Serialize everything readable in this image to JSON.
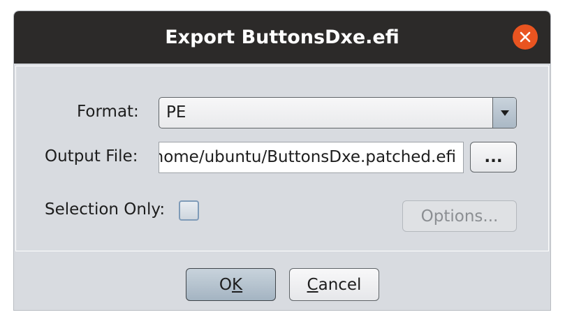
{
  "dialog": {
    "title": "Export ButtonsDxe.efi",
    "close_icon": "close-icon",
    "accent_color": "#e95420"
  },
  "form": {
    "format_label": "Format:",
    "format_value": "PE",
    "output_label": "Output File:",
    "output_value": "/home/ubuntu/ButtonsDxe.patched.efi",
    "browse_label": "...",
    "selection_label": "Selection Only:",
    "selection_checked": false,
    "options_label": "Options..."
  },
  "buttons": {
    "ok_prefix": "O",
    "ok_mnemonic": "K",
    "cancel_mnemonic": "C",
    "cancel_suffix": "ancel"
  }
}
